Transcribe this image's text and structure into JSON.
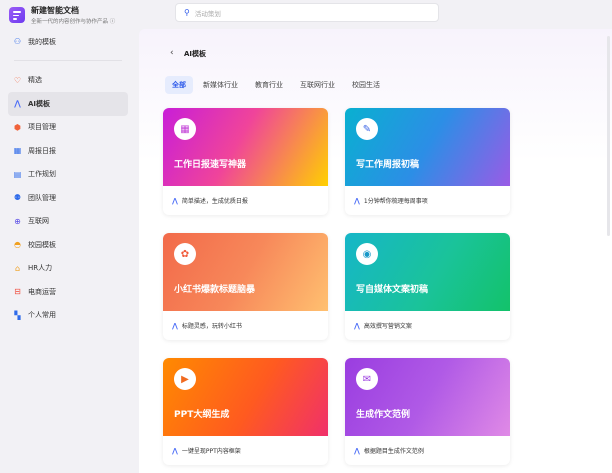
{
  "app": {
    "title": "新建智能文档",
    "subtitle": "全新一代的内容创作与协作产品 ⓘ"
  },
  "search": {
    "placeholder": "活动策划"
  },
  "sidebar": {
    "items": [
      {
        "label": "我的模板",
        "icon": "user-icon",
        "color": "#2f6bea"
      },
      {
        "label": "精选",
        "icon": "heart-badge-icon",
        "color": "#f0623a"
      },
      {
        "label": "AI模板",
        "icon": "ai-icon",
        "color": "#4a6cf7"
      },
      {
        "label": "项目管理",
        "icon": "cube-icon",
        "color": "#f0623a"
      },
      {
        "label": "周报日报",
        "icon": "calendar-icon",
        "color": "#2f6bea"
      },
      {
        "label": "工作规划",
        "icon": "clipboard-icon",
        "color": "#2f6bea"
      },
      {
        "label": "团队管理",
        "icon": "team-icon",
        "color": "#2f6bea"
      },
      {
        "label": "互联网",
        "icon": "globe-icon",
        "color": "#5a4de6"
      },
      {
        "label": "校园模板",
        "icon": "graduation-cap-icon",
        "color": "#f0a020"
      },
      {
        "label": "HR人力",
        "icon": "lock-person-icon",
        "color": "#f0a020"
      },
      {
        "label": "电商运营",
        "icon": "store-icon",
        "color": "#f04a3a"
      },
      {
        "label": "个人常用",
        "icon": "grid-icon",
        "color": "#2f6bea"
      }
    ]
  },
  "main": {
    "back": "‹",
    "title": "AI模板",
    "tabs": [
      "全部",
      "新媒体行业",
      "教育行业",
      "互联网行业",
      "校园生活"
    ],
    "cards": [
      {
        "title": "工作日报速写神器",
        "desc": "简单描述，生成优质日报",
        "icon": "calendar-icon",
        "gradient": "linear-gradient(120deg,#c81ed8 0%,#f0449a 45%,#ffd000 100%)",
        "color": "#c13fd6"
      },
      {
        "title": "写工作周报初稿",
        "desc": "1分钟帮你梳理每周事项",
        "icon": "edit-icon",
        "gradient": "linear-gradient(120deg,#09b0d0 0%,#2c8ee6 50%,#9a5be6 100%)",
        "color": "#3b64e6"
      },
      {
        "title": "小红书爆款标题脑暴",
        "desc": "标题灵感，玩转小红书",
        "icon": "redbook-icon",
        "gradient": "linear-gradient(120deg,#f26a4a 0%,#f7885a 50%,#ffc070 100%)",
        "color": "#f05a3a"
      },
      {
        "title": "写自媒体文案初稿",
        "desc": "高效撰写营销文案",
        "icon": "person-icon",
        "gradient": "linear-gradient(120deg,#16b6c8 0%,#1ac39a 55%,#13c26a 100%)",
        "color": "#1898c8"
      },
      {
        "title": "PPT大纲生成",
        "desc": "一键呈现PPT内容框架",
        "icon": "play-icon",
        "gradient": "linear-gradient(120deg,#ff8a00 0%,#ff5a20 55%,#f0306a 100%)",
        "color": "#f06a20"
      },
      {
        "title": "生成作文范例",
        "desc": "根据题目生成作文范例",
        "icon": "mail-icon",
        "gradient": "linear-gradient(120deg,#9a3de0 0%,#b05ae6 50%,#e08ae6 100%)",
        "color": "#9b3de0"
      }
    ]
  }
}
